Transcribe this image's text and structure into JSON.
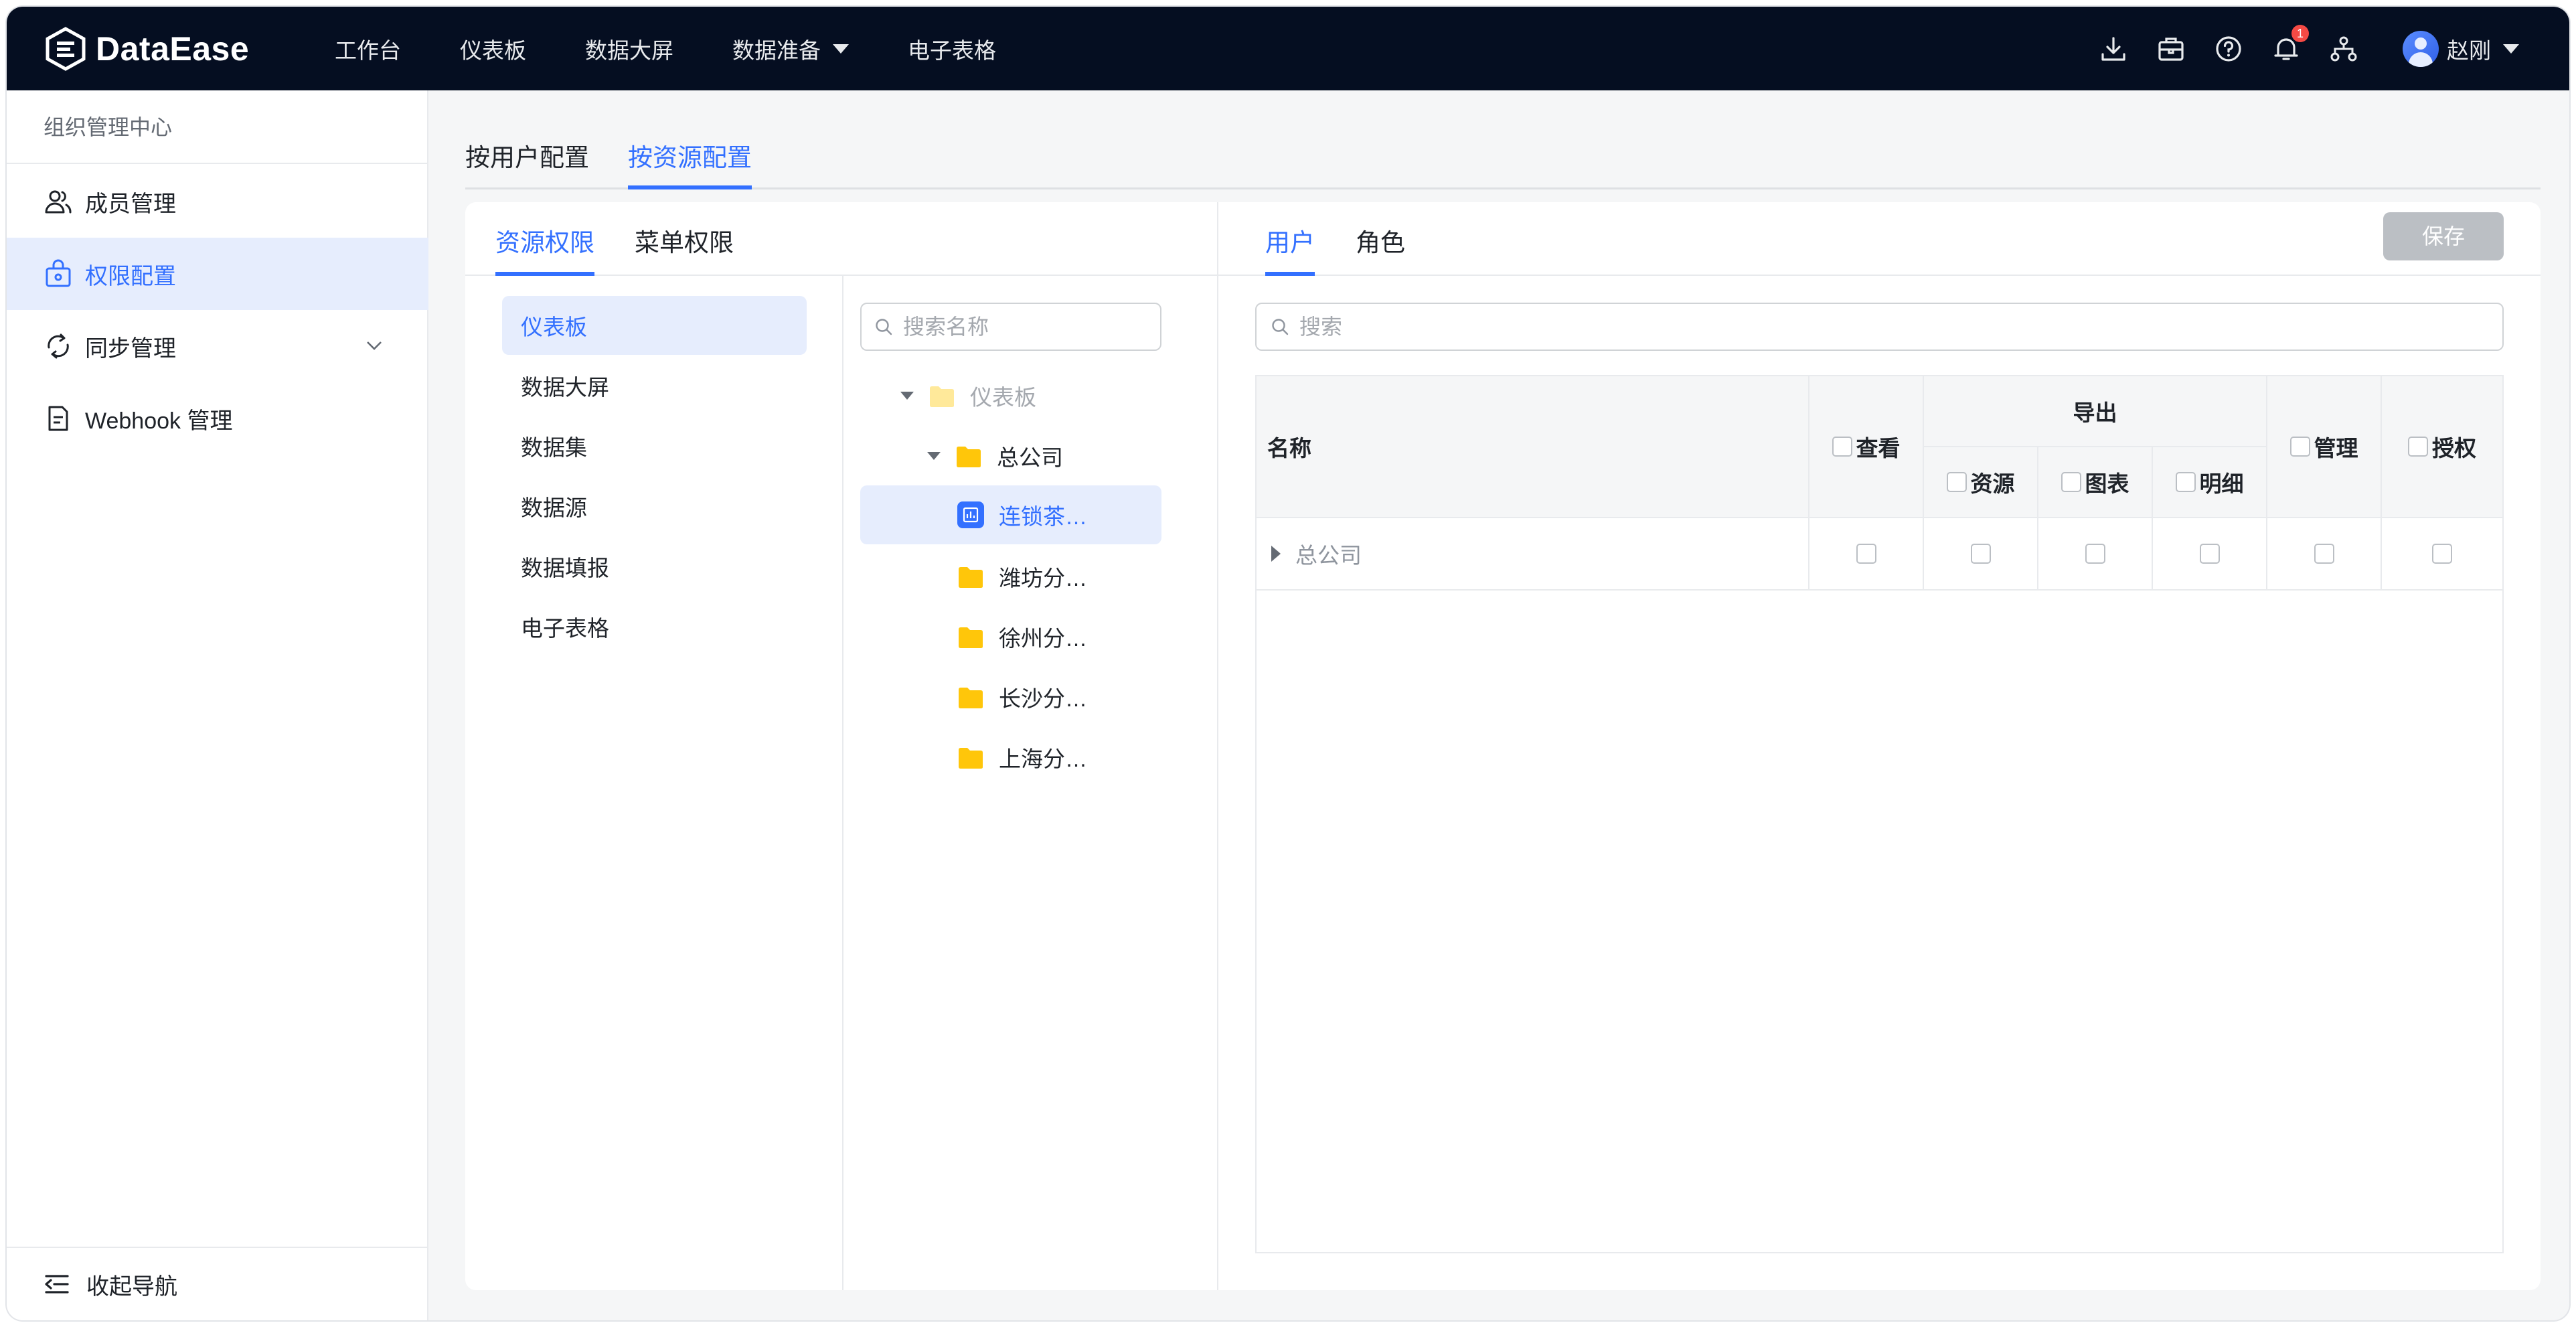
{
  "app": {
    "brand": "DataEase"
  },
  "topnav": {
    "items": [
      "工作台",
      "仪表板",
      "数据大屏",
      "数据准备",
      "电子表格"
    ]
  },
  "header": {
    "notification_count": "1",
    "user_name": "赵刚"
  },
  "sidebar": {
    "title": "组织管理中心",
    "items": [
      {
        "label": "成员管理",
        "icon": "users-icon"
      },
      {
        "label": "权限配置",
        "icon": "lock-bag-icon",
        "active": true
      },
      {
        "label": "同步管理",
        "icon": "sync-icon"
      },
      {
        "label": "Webhook 管理",
        "icon": "document-icon"
      }
    ],
    "collapse_label": "收起导航"
  },
  "main_tabs": [
    "按用户配置",
    "按资源配置"
  ],
  "sub_tabs": [
    "资源权限",
    "菜单权限"
  ],
  "resource_types": [
    "仪表板",
    "数据大屏",
    "数据集",
    "数据源",
    "数据填报",
    "电子表格"
  ],
  "tree": {
    "search_placeholder": "搜索名称",
    "nodes": [
      "仪表板",
      "总公司",
      "连锁茶…",
      "潍坊分…",
      "徐州分…",
      "长沙分…",
      "上海分…"
    ]
  },
  "right_tabs": [
    "用户",
    "角色"
  ],
  "save_label": "保存",
  "table": {
    "search_placeholder": "搜索",
    "headers": {
      "name": "名称",
      "view": "查看",
      "export": "导出",
      "export_resource": "资源",
      "export_chart": "图表",
      "export_detail": "明细",
      "manage": "管理",
      "authorize": "授权"
    },
    "rows": [
      {
        "name": "总公司"
      }
    ]
  },
  "colors": {
    "header_bg": "#050e21",
    "accent": "#3370ff",
    "active_bg": "#e6edfd",
    "folder": "#ffc60a"
  }
}
